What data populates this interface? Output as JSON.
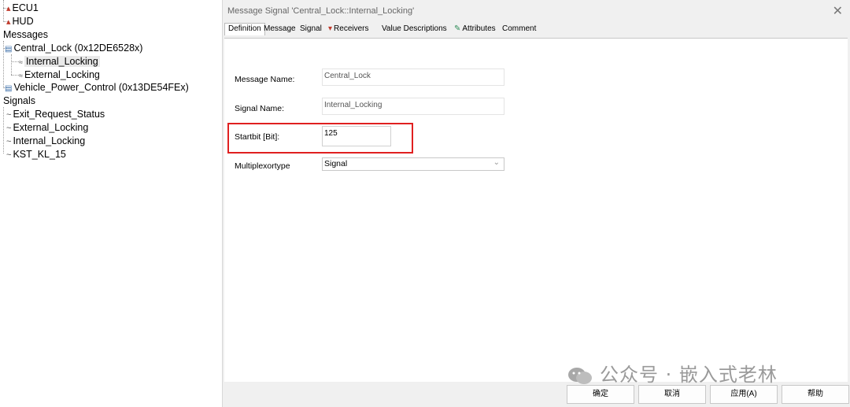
{
  "tree": {
    "ecu1": "ECU1",
    "hud": "HUD",
    "messages_header": "Messages",
    "msg_central_lock": "Central_Lock (0x12DE6528x)",
    "sig_internal_locking": "Internal_Locking",
    "sig_external_locking": "External_Locking",
    "msg_vehicle_power": "Vehicle_Power_Control (0x13DE54FEx)",
    "signals_header": "Signals",
    "signals": [
      "Exit_Request_Status",
      "External_Locking",
      "Internal_Locking",
      "KST_KL_15"
    ]
  },
  "dialog": {
    "title": "Message Signal 'Central_Lock::Internal_Locking'",
    "tabs": [
      "Definition",
      "Message",
      "Signal",
      "Receivers",
      "Value Descriptions",
      "Attributes",
      "Comment"
    ],
    "active_tab": "Definition",
    "fields": {
      "message_name_label": "Message Name:",
      "message_name_value": "Central_Lock",
      "signal_name_label": "Signal Name:",
      "signal_name_value": "Internal_Locking",
      "startbit_label": "Startbit [Bit]:",
      "startbit_value": "125",
      "multiplexortype_label": "Multiplexortype",
      "multiplexortype_value": "Signal"
    },
    "buttons": {
      "ok": "确定",
      "cancel": "取消",
      "apply": "应用(A)",
      "help": "帮助"
    }
  },
  "watermark": "公众号 · 嵌入式老林",
  "colors": {
    "highlight": "#e02020",
    "dialog_bg": "#f0f0f0"
  }
}
